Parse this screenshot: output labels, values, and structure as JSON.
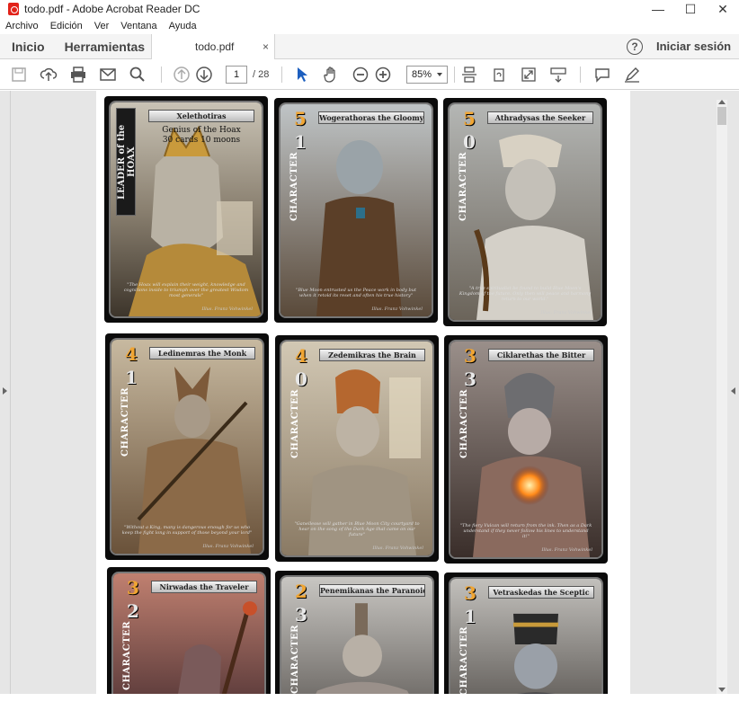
{
  "window": {
    "title": "todo.pdf - Adobe Acrobat Reader DC",
    "minimize": "—",
    "maximize": "☐",
    "close": "✕"
  },
  "menu": [
    "Archivo",
    "Edición",
    "Ver",
    "Ventana",
    "Ayuda"
  ],
  "tabs": {
    "home": "Inicio",
    "tools": "Herramientas",
    "document": "todo.pdf",
    "close": "×",
    "help": "?",
    "signin": "Iniciar sesión"
  },
  "toolbar": {
    "current_page": "1",
    "total_pages": "/ 28",
    "zoom": "85%"
  },
  "cards": [
    {
      "name": "Xelethotiras",
      "cost": "",
      "power": "",
      "type": "LEADER of the HOAX",
      "subtitle1": "Genius of the Hoax",
      "subtitle2": "30 cards 10 moons",
      "illustrator": "Illus. Franz Vohwinkel",
      "flavor": "\"The Hoax will explain their weight, knowledge and cognitions inside to triumph over the greatest Wisdom most generals\""
    },
    {
      "name": "Wogerathoras the Gloomy",
      "cost": "5",
      "power": "1",
      "type": "CHARACTER",
      "illustrator": "Illus. Franz Vohwinkel",
      "flavor": "\"Blue Moon entrusted us the Peace work in body but when it retold its reset and often his true history\""
    },
    {
      "name": "Athradysas the Seeker",
      "cost": "5",
      "power": "0",
      "type": "CHARACTER",
      "illustrator": "Illus. Franz Vohwinkel",
      "flavor": "\"A true spiritualist be found to build Blue Moon's Kingdom of the future. Only then will peace and harmony return to our world.\""
    },
    {
      "name": "Ledinemras the Monk",
      "cost": "4",
      "power": "1",
      "type": "CHARACTER",
      "illustrator": "Illus. Franz Vohwinkel",
      "flavor": "\"Without a King, many is dangerous enough for us who keep the fight long in support of those beyond your lord\""
    },
    {
      "name": "Zedemikras the Brain",
      "cost": "4",
      "power": "0",
      "type": "CHARACTER",
      "illustrator": "Illus. Franz Vohwinkel",
      "flavor": "\"Ganellesse will gather in Blue Moon City courtyard to hear on the song of the Dark Age that came on our future\""
    },
    {
      "name": "Ciklarethas the Bitter",
      "cost": "3",
      "power": "3",
      "type": "CHARACTER",
      "illustrator": "Illus. Franz Vohwinkel",
      "flavor": "\"The fiery Vulcan will return from the ink. Then as a Dark understand if they never follow his lines to understand it!\""
    },
    {
      "name": "Nirwadas the Traveler",
      "cost": "3",
      "power": "2",
      "type": "CHARACTER",
      "illustrator": "",
      "flavor": ""
    },
    {
      "name": "Penemikanas the Paranoid",
      "cost": "2",
      "power": "3",
      "type": "CHARACTER",
      "illustrator": "",
      "flavor": ""
    },
    {
      "name": "Vetraskedas the Sceptic",
      "cost": "3",
      "power": "1",
      "type": "CHARACTER",
      "illustrator": "",
      "flavor": ""
    }
  ]
}
